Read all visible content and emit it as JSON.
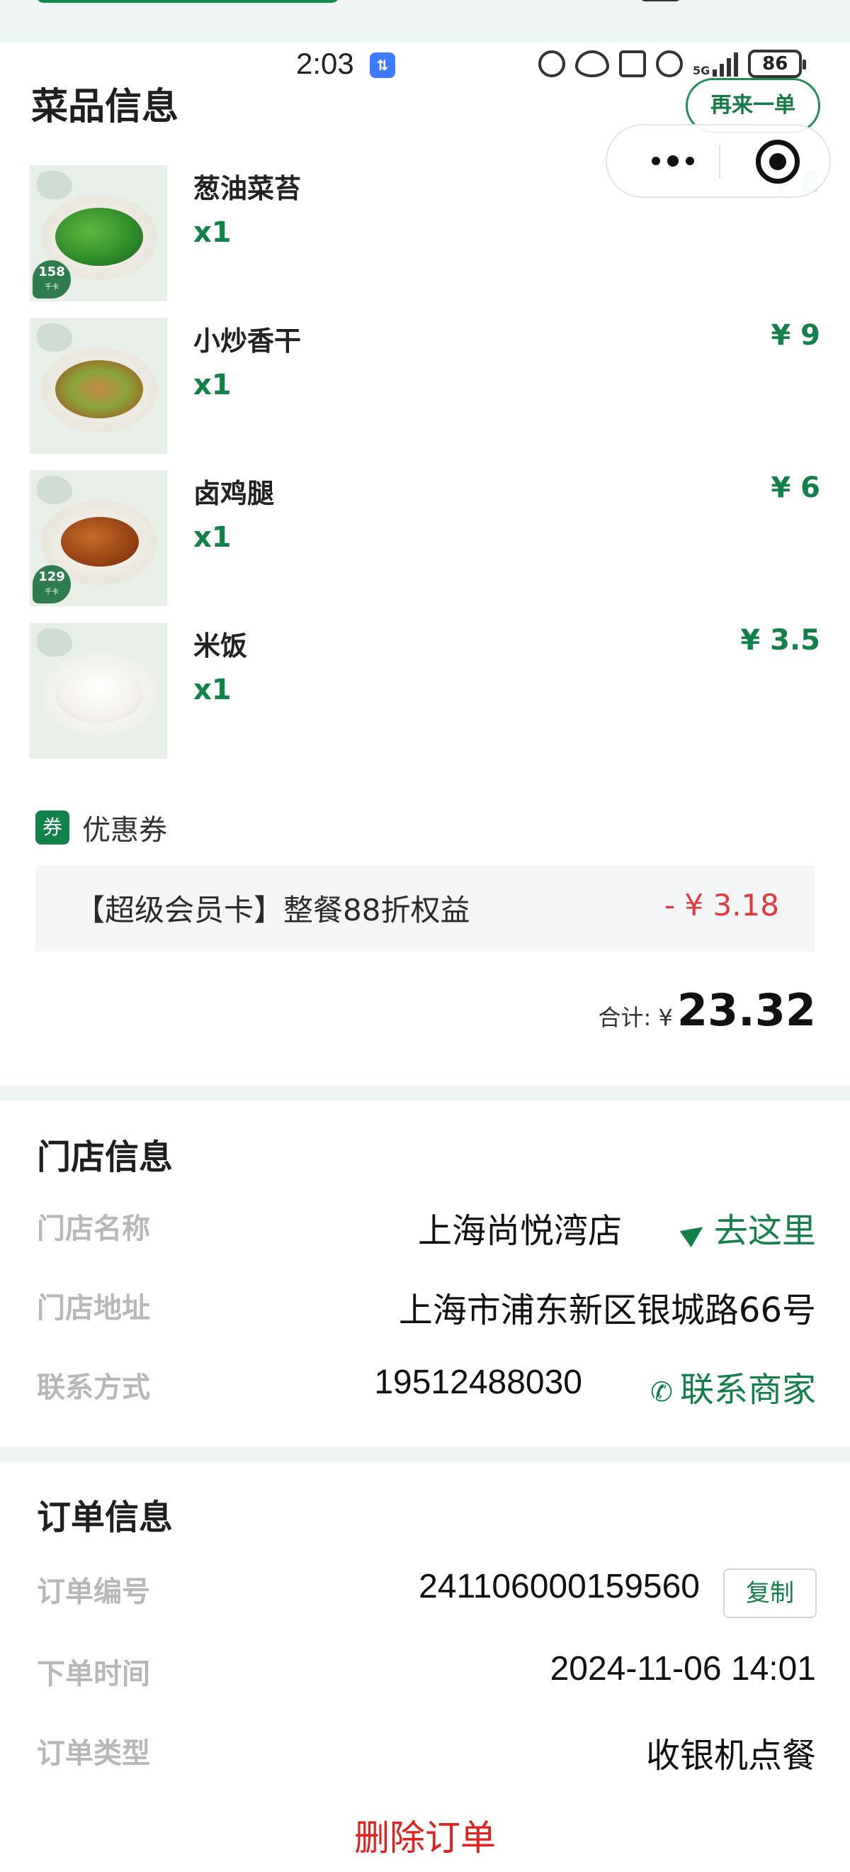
{
  "status_bar": {
    "time": "2:03",
    "battery": "86",
    "network": "5G"
  },
  "dishes_section": {
    "title": "菜品信息",
    "reorder_label": "再来一单"
  },
  "dishes": [
    {
      "name": "葱油菜苔",
      "qty": "x1",
      "price": "¥ 8",
      "kcal": "158",
      "kcal_unit": "千卡"
    },
    {
      "name": "小炒香干",
      "qty": "x1",
      "price": "¥ 9"
    },
    {
      "name": "卤鸡腿",
      "qty": "x1",
      "price": "¥ 6",
      "kcal": "129",
      "kcal_unit": "千卡"
    },
    {
      "name": "米饭",
      "qty": "x1",
      "price": "¥ 3.5"
    }
  ],
  "coupon": {
    "badge": "券",
    "label": "优惠券",
    "description": "【超级会员卡】整餐88折权益",
    "amount": "- ¥ 3.18"
  },
  "total": {
    "label": "合计: ¥",
    "value": "23.32"
  },
  "store": {
    "title": "门店信息",
    "name_key": "门店名称",
    "name_value": "上海尚悦湾店",
    "navigate_label": "去这里",
    "address_key": "门店地址",
    "address_value": "上海市浦东新区银城路66号",
    "contact_key": "联系方式",
    "contact_value": "19512488030",
    "contact_label": "联系商家"
  },
  "order": {
    "title": "订单信息",
    "number_key": "订单编号",
    "number_value": "241106000159560",
    "copy_label": "复制",
    "time_key": "下单时间",
    "time_value": "2024-11-06 14:01",
    "type_key": "订单类型",
    "type_value": "收银机点餐",
    "delete_label": "删除订单"
  },
  "colors": {
    "brand_green": "#128049",
    "discount_red": "#e4393c",
    "delete_red": "#e3201d",
    "section_bg": "#eef4f2"
  }
}
